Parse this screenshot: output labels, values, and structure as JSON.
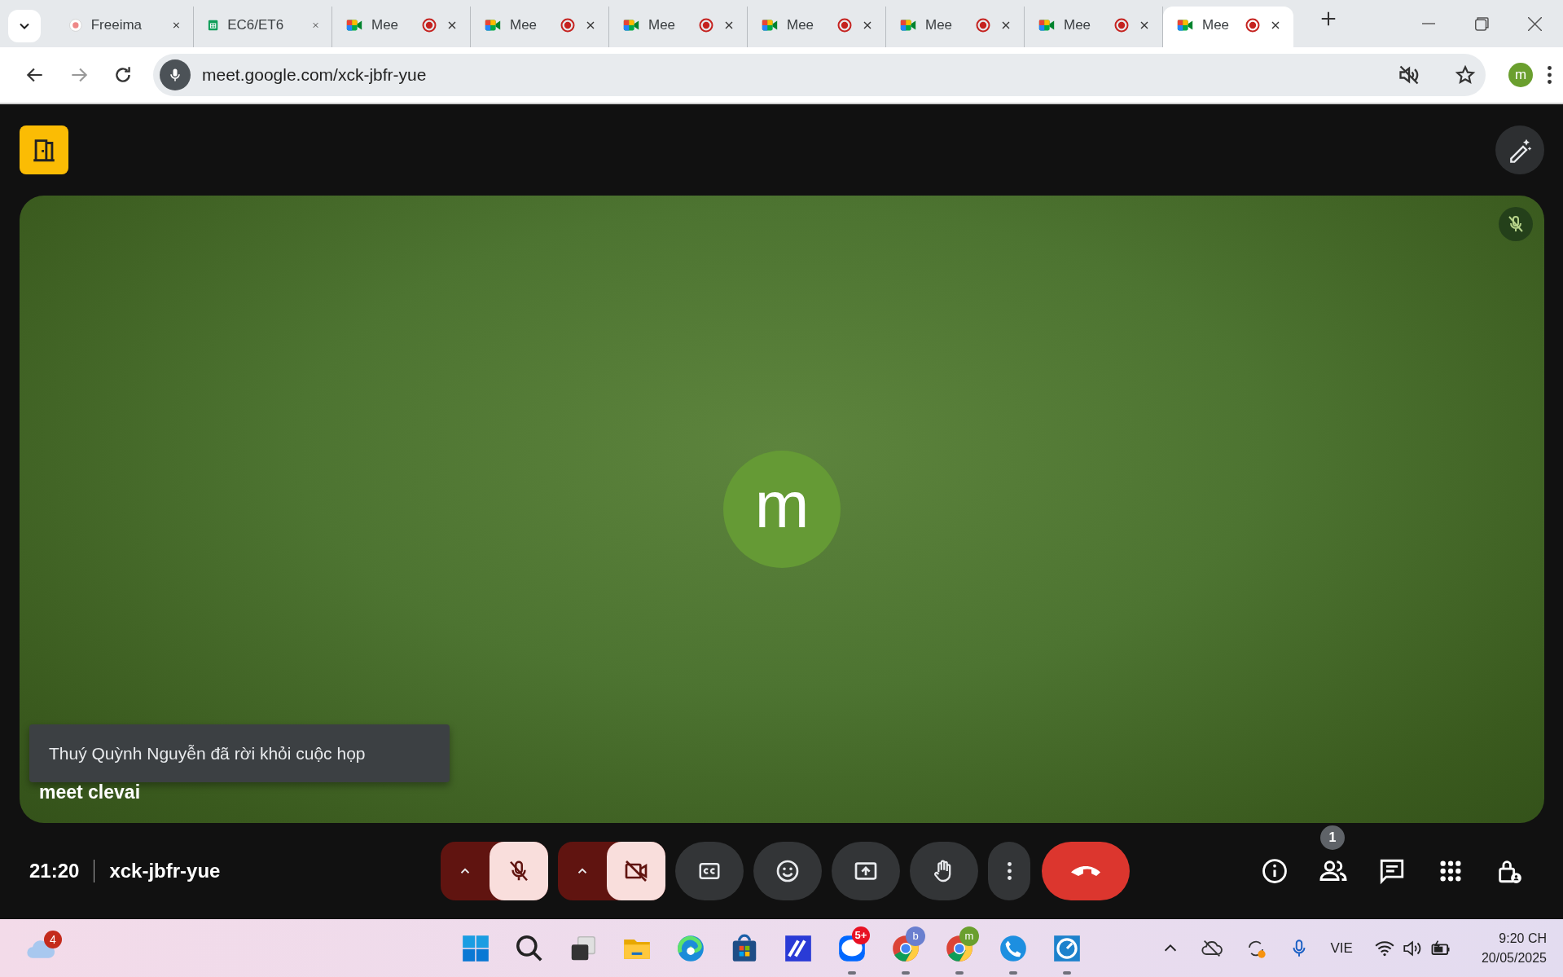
{
  "browser": {
    "tabs": [
      {
        "title": "Freeima",
        "kind": "generic",
        "recording": false,
        "selected": false
      },
      {
        "title": "EC6/ET6",
        "kind": "sheets",
        "recording": false,
        "selected": false
      },
      {
        "title": "Mee",
        "kind": "meet",
        "recording": true,
        "selected": false
      },
      {
        "title": "Mee",
        "kind": "meet",
        "recording": true,
        "selected": false
      },
      {
        "title": "Mee",
        "kind": "meet",
        "recording": true,
        "selected": false
      },
      {
        "title": "Mee",
        "kind": "meet",
        "recording": true,
        "selected": false
      },
      {
        "title": "Mee",
        "kind": "meet",
        "recording": true,
        "selected": false
      },
      {
        "title": "Mee",
        "kind": "meet",
        "recording": true,
        "selected": false
      },
      {
        "title": "Mee",
        "kind": "meet",
        "recording": true,
        "selected": true
      }
    ],
    "url": "meet.google.com/xck-jbfr-yue",
    "profile": "m"
  },
  "meeting": {
    "participant": {
      "initial": "m",
      "name": "meet clevai",
      "muted": true
    },
    "toast": "Thuý Quỳnh Nguyễn đã rời khỏi cuộc họp",
    "clock": "21:20",
    "code": "xck-jbfr-yue",
    "microphone_on": false,
    "camera_on": false,
    "people_count": "1"
  },
  "taskbar": {
    "weather_badge": "4",
    "apps": [
      {
        "kind": "start",
        "running": false
      },
      {
        "kind": "search",
        "running": false
      },
      {
        "kind": "task-view",
        "running": false
      },
      {
        "kind": "folder",
        "running": false
      },
      {
        "kind": "edge",
        "running": false
      },
      {
        "kind": "store",
        "running": false
      },
      {
        "kind": "pen-app",
        "running": false
      },
      {
        "kind": "zalo",
        "badge": "5+",
        "running": true
      },
      {
        "kind": "chrome",
        "profile": "b",
        "running": true
      },
      {
        "kind": "chrome",
        "profile": "m",
        "running": true
      },
      {
        "kind": "phone",
        "running": true
      },
      {
        "kind": "gauge",
        "running": true
      }
    ],
    "language": "VIE",
    "time": "9:20 CH",
    "date": "20/05/2025"
  }
}
